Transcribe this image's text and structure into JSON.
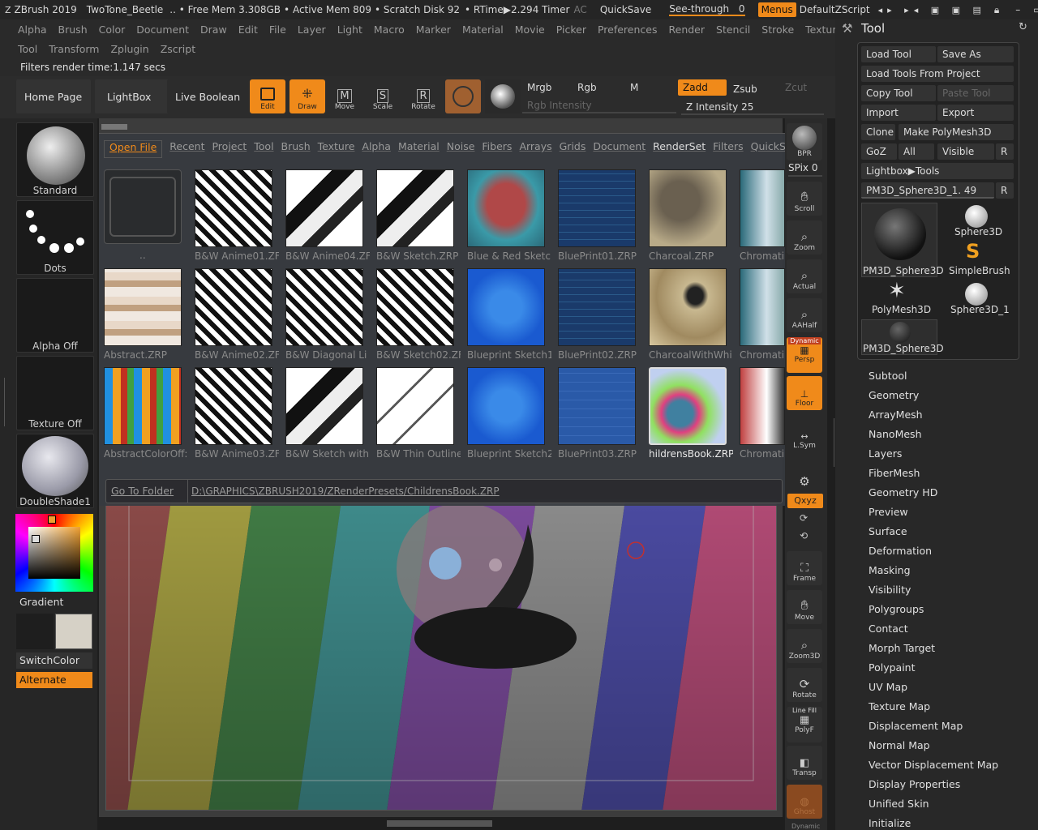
{
  "title_bar": {
    "app": "ZBrush 2019",
    "document": "TwoTone_Beetle",
    "free_mem": ".. • Free Mem 3.308GB",
    "active_mem": "• Active Mem 809",
    "scratch": "• Scratch Disk 92",
    "rtime": "• RTime▶2.294 Timer",
    "ac": "AC",
    "quicksave": "QuickSave",
    "see_through": "See-through",
    "see_through_value": "0",
    "menus": "Menus",
    "default_zscript": "DefaultZScript"
  },
  "menu": {
    "row1": [
      "Alpha",
      "Brush",
      "Color",
      "Document",
      "Draw",
      "Edit",
      "File",
      "Layer",
      "Light",
      "Macro",
      "Marker",
      "Material",
      "Movie",
      "Picker",
      "Preferences",
      "Render",
      "Stencil",
      "Stroke",
      "Texture"
    ],
    "row2": [
      "Tool",
      "Transform",
      "Zplugin",
      "Zscript"
    ]
  },
  "info": "Filters render time:1.147 secs",
  "toolbar": {
    "home": "Home Page",
    "lightbox": "LightBox",
    "live_boolean": "Live Boolean",
    "edit": "Edit",
    "draw": "Draw",
    "move": "Move",
    "scale": "Scale",
    "rotate": "Rotate",
    "mrgb": "Mrgb",
    "rgb": "Rgb",
    "m": "M",
    "zadd": "Zadd",
    "zsub": "Zsub",
    "zcut": "Zcut",
    "rgb_intensity": "Rgb Intensity",
    "z_intensity": "Z Intensity",
    "z_intensity_value": "25"
  },
  "left": {
    "brush": "Standard",
    "stroke": "Dots",
    "alpha": "Alpha Off",
    "texture": "Texture Off",
    "material": "DoubleShade1",
    "gradient": "Gradient",
    "switch_color": "SwitchColor",
    "alternate": "Alternate"
  },
  "lightbox": {
    "tabs": [
      "Open File",
      "Recent",
      "Project",
      "Tool",
      "Brush",
      "Texture",
      "Alpha",
      "Material",
      "Noise",
      "Fibers",
      "Arrays",
      "Grids",
      "Document",
      "RenderSet",
      "Filters",
      "QuickSav"
    ],
    "selected_tab": "Open File",
    "folder_label": "..",
    "items": [
      {
        "label": "B&W Anime01.ZF",
        "style": "bw"
      },
      {
        "label": "B&W Anime04.ZF",
        "style": "bwship"
      },
      {
        "label": "B&W Sketch.ZRP",
        "style": "bwship"
      },
      {
        "label": "Blue & Red Sketcl",
        "style": "bluered"
      },
      {
        "label": "BluePrint01.ZRP",
        "style": "blueprint"
      },
      {
        "label": "Charcoal.ZRP",
        "style": "charcoal"
      },
      {
        "label": "Chromati",
        "style": "chrom"
      },
      {
        "label": "Abstract.ZRP",
        "style": "abstract"
      },
      {
        "label": "B&W Anime02.ZF",
        "style": "bw"
      },
      {
        "label": "B&W Diagonal Li",
        "style": "bw"
      },
      {
        "label": "B&W Sketch02.ZF",
        "style": "bw"
      },
      {
        "label": "Blueprint Sketch1",
        "style": "bluebright"
      },
      {
        "label": "BluePrint02.ZRP",
        "style": "blueprint"
      },
      {
        "label": "CharcoalWithWhi",
        "style": "charcoal2"
      },
      {
        "label": "Chromati",
        "style": "chrom"
      },
      {
        "label": "AbstractColorOff:",
        "style": "abscolor"
      },
      {
        "label": "B&W Anime03.ZF",
        "style": "bw"
      },
      {
        "label": "B&W Sketch with",
        "style": "bwship"
      },
      {
        "label": "B&W Thin Outline",
        "style": "thin"
      },
      {
        "label": "Blueprint Sketch2",
        "style": "bluebright"
      },
      {
        "label": "BluePrint03.ZRP",
        "style": "blueship"
      },
      {
        "label": "hildrensBook.ZRP",
        "style": "children"
      },
      {
        "label": "Chromati",
        "style": "chromred"
      }
    ],
    "go_to_folder": "Go To Folder",
    "path": "D:\\GRAPHICS\\ZBRUSH2019/ZRenderPresets/ChildrensBook.ZRP"
  },
  "right_strip": {
    "bpr": "BPR",
    "spix": "SPix",
    "spix_value": "0",
    "scroll": "Scroll",
    "zoom": "Zoom",
    "actual": "Actual",
    "aahalf": "AAHalf",
    "dynamic": "Dynamic",
    "persp": "Persp",
    "floor": "Floor",
    "lsym": "L.Sym",
    "xyz": "Qxyz",
    "frame": "Frame",
    "move": "Move",
    "zoom3d": "Zoom3D",
    "rotate": "Rotate",
    "line_fill": "Line Fill",
    "polyf": "PolyF",
    "transp": "Transp",
    "ghost": "Ghost",
    "dynamic2": "Dynamic"
  },
  "tool_panel": {
    "title": "Tool",
    "load_tool": "Load Tool",
    "save_as": "Save As",
    "load_from_project": "Load Tools From Project",
    "copy_tool": "Copy Tool",
    "paste_tool": "Paste Tool",
    "import": "Import",
    "export": "Export",
    "clone": "Clone",
    "make_polymesh": "Make PolyMesh3D",
    "goz": "GoZ",
    "all": "All",
    "visible": "Visible",
    "r": "R",
    "lightbox_tools": "Lightbox▶Tools",
    "current_tool": "PM3D_Sphere3D_1.",
    "current_value": "49",
    "meshes": [
      "PM3D_Sphere3D",
      "Sphere3D",
      "SimpleBrush",
      "PolyMesh3D",
      "Sphere3D_1",
      "PM3D_Sphere3D"
    ],
    "subpalettes": [
      "Subtool",
      "Geometry",
      "ArrayMesh",
      "NanoMesh",
      "Layers",
      "FiberMesh",
      "Geometry HD",
      "Preview",
      "Surface",
      "Deformation",
      "Masking",
      "Visibility",
      "Polygroups",
      "Contact",
      "Morph Target",
      "Polypaint",
      "UV Map",
      "Texture Map",
      "Displacement Map",
      "Normal Map",
      "Vector Displacement Map",
      "Display Properties",
      "Unified Skin",
      "Initialize"
    ]
  },
  "colors": {
    "accent": "#f08a1a",
    "panel": "#282828"
  }
}
